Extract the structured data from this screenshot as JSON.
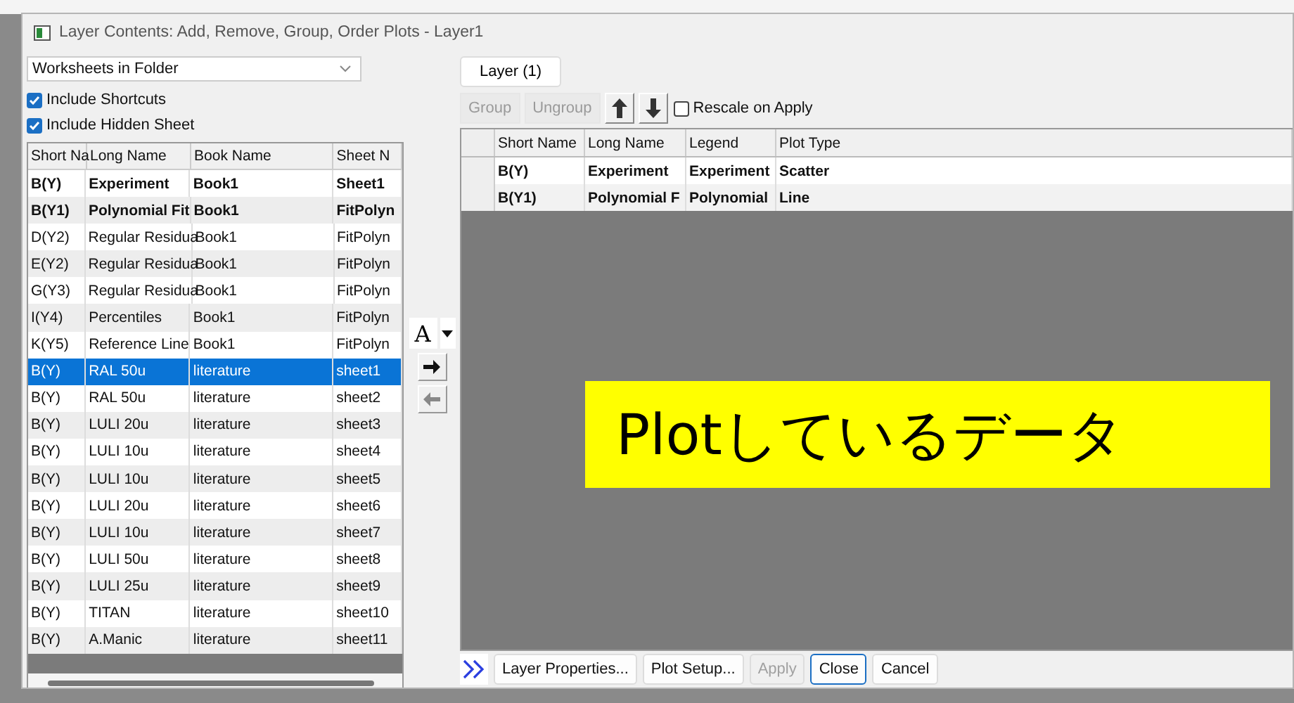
{
  "window": {
    "title": "Layer Contents: Add, Remove, Group, Order Plots - Layer1"
  },
  "source": {
    "value": "Worksheets in Folder"
  },
  "options": [
    {
      "label": "Include Shortcuts",
      "checked": true
    },
    {
      "label": "Include Hidden Sheet",
      "checked": true
    }
  ],
  "available": {
    "columns": [
      "Short Na",
      "Long Name",
      "Book Name",
      "Sheet N"
    ],
    "rows": [
      {
        "cells": [
          "B(Y)",
          "Experiment",
          "Book1",
          "Sheet1"
        ],
        "plotted": true,
        "selected": false
      },
      {
        "cells": [
          "B(Y1)",
          "Polynomial Fit",
          "Book1",
          "FitPolyn"
        ],
        "plotted": true,
        "selected": false
      },
      {
        "cells": [
          "D(Y2)",
          "Regular Residua",
          "Book1",
          "FitPolyn"
        ],
        "plotted": false,
        "selected": false
      },
      {
        "cells": [
          "E(Y2)",
          "Regular Residua",
          "Book1",
          "FitPolyn"
        ],
        "plotted": false,
        "selected": false
      },
      {
        "cells": [
          "G(Y3)",
          "Regular Residua",
          "Book1",
          "FitPolyn"
        ],
        "plotted": false,
        "selected": false
      },
      {
        "cells": [
          "I(Y4)",
          "Percentiles",
          "Book1",
          "FitPolyn"
        ],
        "plotted": false,
        "selected": false
      },
      {
        "cells": [
          "K(Y5)",
          "Reference Line",
          "Book1",
          "FitPolyn"
        ],
        "plotted": false,
        "selected": false
      },
      {
        "cells": [
          "B(Y)",
          "RAL 50u",
          "literature",
          "sheet1"
        ],
        "plotted": false,
        "selected": true
      },
      {
        "cells": [
          "B(Y)",
          "RAL 50u",
          "literature",
          "sheet2"
        ],
        "plotted": false,
        "selected": false
      },
      {
        "cells": [
          "B(Y)",
          "LULI 20u",
          "literature",
          "sheet3"
        ],
        "plotted": false,
        "selected": false
      },
      {
        "cells": [
          "B(Y)",
          "LULI 10u",
          "literature",
          "sheet4"
        ],
        "plotted": false,
        "selected": false
      },
      {
        "cells": [
          "B(Y)",
          "LULI 10u",
          "literature",
          "sheet5"
        ],
        "plotted": false,
        "selected": false
      },
      {
        "cells": [
          "B(Y)",
          "LULI 20u",
          "literature",
          "sheet6"
        ],
        "plotted": false,
        "selected": false
      },
      {
        "cells": [
          "B(Y)",
          "LULI 10u",
          "literature",
          "sheet7"
        ],
        "plotted": false,
        "selected": false
      },
      {
        "cells": [
          "B(Y)",
          "LULI 50u",
          "literature",
          "sheet8"
        ],
        "plotted": false,
        "selected": false
      },
      {
        "cells": [
          "B(Y)",
          "LULI 25u",
          "literature",
          "sheet9"
        ],
        "plotted": false,
        "selected": false
      },
      {
        "cells": [
          "B(Y)",
          "TITAN",
          "literature",
          "sheet10"
        ],
        "plotted": false,
        "selected": false
      },
      {
        "cells": [
          "B(Y)",
          "A.Manic",
          "literature",
          "sheet11"
        ],
        "plotted": false,
        "selected": false
      }
    ]
  },
  "middle_buttons": {
    "font_glyph": "A"
  },
  "layer_tab": {
    "label": "Layer (1)"
  },
  "toolbar": [
    {
      "label": "Group",
      "disabled": true
    },
    {
      "label": "Ungroup",
      "disabled": true
    }
  ],
  "rescale": {
    "label": "Rescale on Apply",
    "checked": false
  },
  "layer_contents": {
    "columns": [
      "Short Name",
      "Long Name",
      "Legend",
      "Plot Type"
    ],
    "rows": [
      {
        "cells": [
          "B(Y)",
          "Experiment",
          "Experiment",
          "Scatter"
        ]
      },
      {
        "cells": [
          "B(Y1)",
          "Polynomial F",
          "Polynomial",
          "Line"
        ]
      }
    ]
  },
  "annotation": {
    "text": "Plotしているデータ"
  },
  "buttons": [
    {
      "label": "Layer Properties...",
      "disabled": false,
      "focused": false
    },
    {
      "label": "Plot Setup...",
      "disabled": false,
      "focused": false
    },
    {
      "label": "Apply",
      "disabled": true,
      "focused": false
    },
    {
      "label": "Close",
      "disabled": false,
      "focused": true
    },
    {
      "label": "Cancel",
      "disabled": false,
      "focused": false
    }
  ]
}
